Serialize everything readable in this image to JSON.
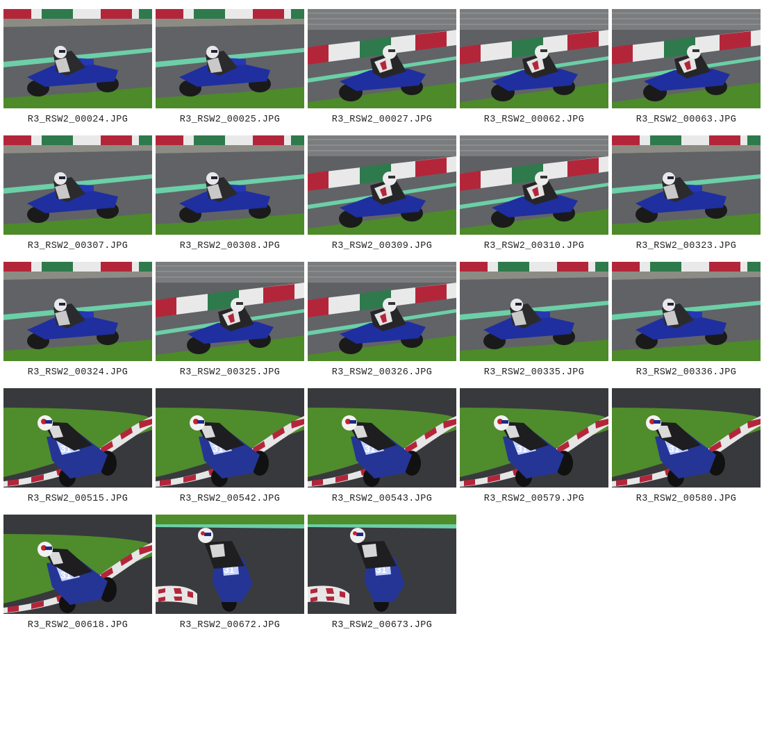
{
  "colors": {
    "asphalt": "#5b5d60",
    "asphalt_dark": "#3c3e41",
    "grass": "#4d8a2a",
    "kerb_red": "#b3263a",
    "kerb_white": "#e9e9e9",
    "kerb_green": "#2e7a4c",
    "track_line": "#6ccfa8",
    "bike_blue": "#1f2fa0"
  },
  "photos": [
    {
      "filename": "R3_RSW2_00024.JPG",
      "scene": "straight"
    },
    {
      "filename": "R3_RSW2_00025.JPG",
      "scene": "straight"
    },
    {
      "filename": "R3_RSW2_00027.JPG",
      "scene": "straight-fence"
    },
    {
      "filename": "R3_RSW2_00062.JPG",
      "scene": "straight-fence"
    },
    {
      "filename": "R3_RSW2_00063.JPG",
      "scene": "straight-fence"
    },
    {
      "filename": "R3_RSW2_00307.JPG",
      "scene": "straight"
    },
    {
      "filename": "R3_RSW2_00308.JPG",
      "scene": "straight"
    },
    {
      "filename": "R3_RSW2_00309.JPG",
      "scene": "straight-fence"
    },
    {
      "filename": "R3_RSW2_00310.JPG",
      "scene": "straight-fence"
    },
    {
      "filename": "R3_RSW2_00323.JPG",
      "scene": "straight"
    },
    {
      "filename": "R3_RSW2_00324.JPG",
      "scene": "straight"
    },
    {
      "filename": "R3_RSW2_00325.JPG",
      "scene": "straight-fence"
    },
    {
      "filename": "R3_RSW2_00326.JPG",
      "scene": "straight-fence"
    },
    {
      "filename": "R3_RSW2_00335.JPG",
      "scene": "straight"
    },
    {
      "filename": "R3_RSW2_00336.JPG",
      "scene": "straight"
    },
    {
      "filename": "R3_RSW2_00515.JPG",
      "scene": "corner"
    },
    {
      "filename": "R3_RSW2_00542.JPG",
      "scene": "corner"
    },
    {
      "filename": "R3_RSW2_00543.JPG",
      "scene": "corner"
    },
    {
      "filename": "R3_RSW2_00579.JPG",
      "scene": "corner"
    },
    {
      "filename": "R3_RSW2_00580.JPG",
      "scene": "corner"
    },
    {
      "filename": "R3_RSW2_00618.JPG",
      "scene": "corner"
    },
    {
      "filename": "R3_RSW2_00672.JPG",
      "scene": "corner-upright"
    },
    {
      "filename": "R3_RSW2_00673.JPG",
      "scene": "corner-upright"
    }
  ]
}
